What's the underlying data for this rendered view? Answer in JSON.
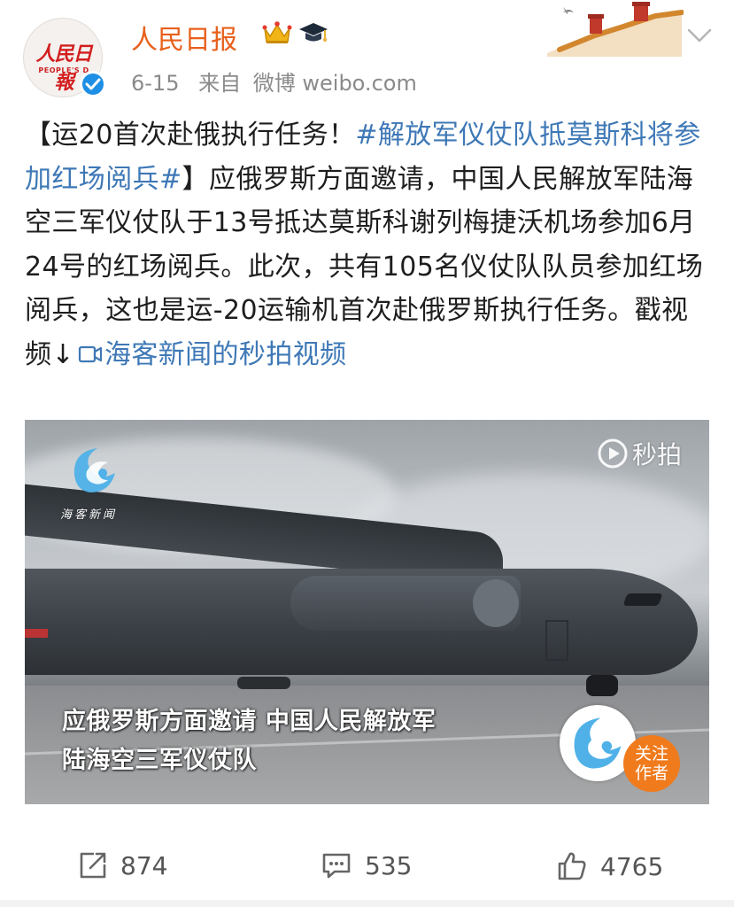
{
  "post": {
    "author": {
      "name": "人民日报",
      "avatar_text": "人民日報",
      "avatar_subtext": "PEOPLE'S D",
      "verified_icon": "verified-badge-icon",
      "badges": [
        "crown-icon",
        "graduation-cap-icon"
      ]
    },
    "meta": {
      "date": "6-15",
      "source_prefix": "来自",
      "source": "微博 weibo.com"
    },
    "text": {
      "title": "【运20首次赴俄执行任务！",
      "hashtag": "#解放军仪仗队抵莫斯科将参加红场阅兵#",
      "body": "】应俄罗斯方面邀请，中国人民解放军陆海空三军仪仗队于13号抵达莫斯科谢列梅捷沃机场参加6月24号的红场阅兵。此次，共有105名仪仗队队员参加红场阅兵，这也是运-20运输机首次赴俄罗斯执行任务。戳视频↓",
      "video_link": "海客新闻的秒拍视频"
    },
    "video": {
      "logo_text": "海客新闻",
      "platform_label": "秒拍",
      "subtitle_line1": "应俄罗斯方面邀请 中国人民解放军",
      "subtitle_line2": "陆海空三军仪仗队",
      "follow_label_1": "关注",
      "follow_label_2": "作者"
    },
    "actions": {
      "reposts": "874",
      "comments": "535",
      "likes": "4765"
    }
  },
  "colors": {
    "author_name": "#e8601c",
    "link": "#3e78b6",
    "meta": "#8a8a8a",
    "follow_button": "#f07b1d",
    "verified": "#1f8fe5"
  }
}
